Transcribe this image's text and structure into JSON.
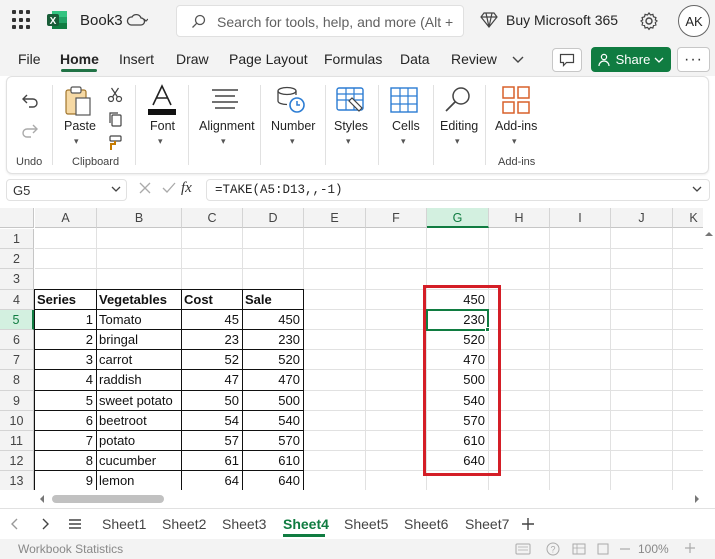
{
  "app": {
    "title": "Book3",
    "autosave_icon": "cloud-sync-icon",
    "search_placeholder": "Search for tools, help, and more (Alt + Q)",
    "buy_label": "Buy Microsoft 365",
    "avatar": "AK",
    "brand_color": "#107c41"
  },
  "menu": {
    "tabs": [
      "File",
      "Home",
      "Insert",
      "Draw",
      "Page Layout",
      "Formulas",
      "Data",
      "Review"
    ],
    "active": "Home",
    "share_label": "Share"
  },
  "ribbon": {
    "undo_group": "Undo",
    "paste": "Paste",
    "clipboard_group": "Clipboard",
    "font": "Font",
    "alignment": "Alignment",
    "number": "Number",
    "styles": "Styles",
    "cells": "Cells",
    "editing": "Editing",
    "addins": "Add-ins",
    "addins_group": "Add-ins"
  },
  "formula_bar": {
    "name_box": "G5",
    "fx": "fx",
    "formula": "=TAKE(A5:D13,,-1)"
  },
  "grid": {
    "columns": [
      "A",
      "B",
      "C",
      "D",
      "E",
      "F",
      "G",
      "H",
      "I",
      "J",
      "K"
    ],
    "rows": [
      "1",
      "2",
      "3",
      "4",
      "5",
      "6",
      "7",
      "8",
      "9",
      "10",
      "11",
      "12",
      "13"
    ],
    "selected_column": "G",
    "selected_row": "5",
    "headers": [
      "Series",
      "Vegetables",
      "Cost",
      "Sale"
    ],
    "table": [
      [
        "1",
        "Tomato",
        "45",
        "450"
      ],
      [
        "2",
        "bringal",
        "23",
        "230"
      ],
      [
        "3",
        "carrot",
        "52",
        "520"
      ],
      [
        "4",
        "raddish",
        "47",
        "470"
      ],
      [
        "5",
        "sweet potato",
        "50",
        "500"
      ],
      [
        "6",
        "beetroot",
        "54",
        "540"
      ],
      [
        "7",
        "potato",
        "57",
        "570"
      ],
      [
        "8",
        "cucumber",
        "61",
        "610"
      ],
      [
        "9",
        "lemon",
        "64",
        "640"
      ]
    ],
    "g_values": [
      "450",
      "230",
      "520",
      "470",
      "500",
      "540",
      "570",
      "610",
      "640"
    ],
    "highlight_color": "#d41e27"
  },
  "sheets": {
    "tabs": [
      "Sheet1",
      "Sheet2",
      "Sheet3",
      "Sheet4",
      "Sheet5",
      "Sheet6",
      "Sheet7"
    ],
    "active": "Sheet4"
  },
  "status": {
    "text": "Workbook Statistics",
    "zoom": "100%"
  }
}
